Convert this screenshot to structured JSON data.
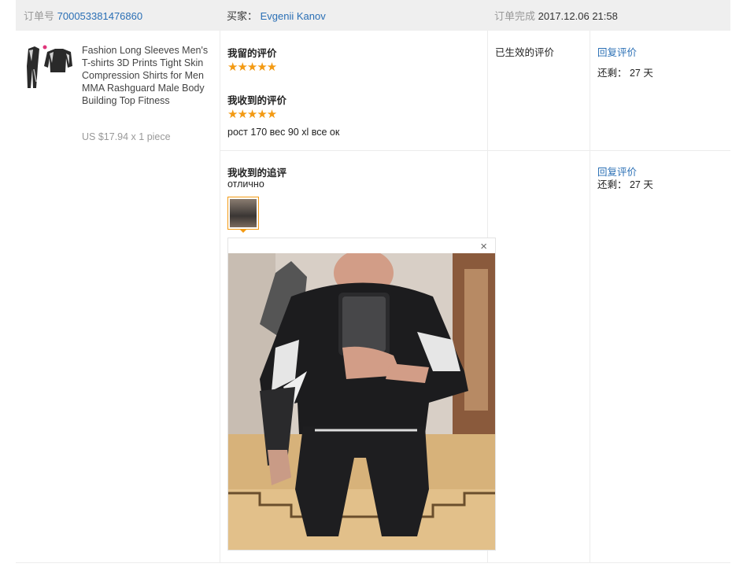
{
  "header": {
    "order_label": "订单号",
    "order_number": "700053381476860",
    "buyer_label": "买家：",
    "buyer_name": "Evgenii Kanov",
    "completed_label": "订单完成",
    "completed_time": "2017.12.06 21:58"
  },
  "product": {
    "title": "Fashion Long Sleeves Men's T-shirts 3D Prints Tight Skin Compression Shirts for Men MMA Rashguard Male Body Building Top Fitness",
    "price": "US $17.94 x 1 piece"
  },
  "reviews": {
    "my_review_label": "我留的评价",
    "my_rating": "★★★★★",
    "received_label": "我收到的评价",
    "received_rating": "★★★★★",
    "received_text": "рост 170 вес 90 xl все ок",
    "status": "已生效的评价",
    "reply_label": "回复评价",
    "remaining": "还剩： 27 天"
  },
  "followup": {
    "label": "我收到的追评",
    "text": "отлично",
    "reply_label": "回复评价",
    "remaining": "还剩： 27 天"
  },
  "preview": {
    "close_icon": "×"
  },
  "colors": {
    "link": "#2a6fb5",
    "star": "#f39a13",
    "header_bg": "#efefef"
  }
}
